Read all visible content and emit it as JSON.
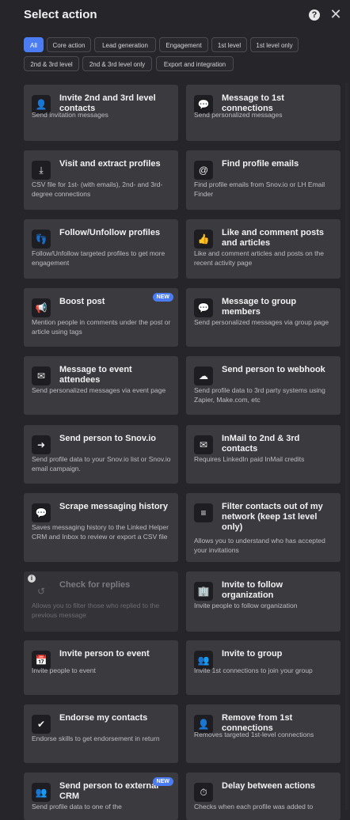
{
  "header": {
    "title": "Select action",
    "help_symbol": "?",
    "close_symbol": "✕"
  },
  "filters": [
    {
      "label": "All",
      "active": true
    },
    {
      "label": "Core action",
      "active": false
    },
    {
      "label": "Lead generation",
      "active": false
    },
    {
      "label": "Engagement",
      "active": false
    },
    {
      "label": "1st level",
      "active": false
    },
    {
      "label": "1st level only",
      "active": false
    },
    {
      "label": "2nd & 3rd level",
      "active": false
    },
    {
      "label": "2nd & 3rd level only",
      "active": false
    },
    {
      "label": "Export and integration",
      "active": false
    }
  ],
  "cards": [
    {
      "title": "Invite 2nd and 3rd level contacts",
      "desc": "Send invitation messages",
      "icon": "invite-user-icon",
      "glyph": "👤"
    },
    {
      "title": "Message to 1st connections",
      "desc": "Send personalized messages",
      "icon": "message-bubble-icon",
      "glyph": "💬"
    },
    {
      "title": "Visit and extract profiles",
      "desc": "CSV file for 1st- (with emails), 2nd- and 3rd-degree connections",
      "icon": "user-download-icon",
      "glyph": "⤓"
    },
    {
      "title": "Find profile emails",
      "desc": "Find profile emails from Snov.io or LH Email Finder",
      "icon": "at-sign-icon",
      "glyph": "@"
    },
    {
      "title": "Follow/Unfollow profiles",
      "desc": "Follow/Unfollow targeted profiles to get more engagement",
      "icon": "footsteps-icon",
      "glyph": "👣"
    },
    {
      "title": "Like and comment posts and articles",
      "desc": "Like and comment articles and posts on the recent activity page",
      "icon": "thumbs-up-icon",
      "glyph": "👍"
    },
    {
      "title": "Boost post",
      "desc": "Mention people in comments under the post or article using tags",
      "icon": "megaphone-icon",
      "glyph": "📢",
      "badge": "NEW"
    },
    {
      "title": "Message to group members",
      "desc": "Send personalized messages via group page",
      "icon": "group-message-icon",
      "glyph": "💬"
    },
    {
      "title": "Message to event attendees",
      "desc": "Send personalized messages via event page",
      "icon": "event-message-icon",
      "glyph": "✉"
    },
    {
      "title": "Send person to webhook",
      "desc": "Send profile data to 3rd party systems using Zapier, Make.com, etc",
      "icon": "cloud-upload-icon",
      "glyph": "☁"
    },
    {
      "title": "Send person to Snov.io",
      "desc": "Send profile data to your Snov.io list or Snov.io email campaign.",
      "icon": "user-send-icon",
      "glyph": "➜"
    },
    {
      "title": "InMail to 2nd & 3rd contacts",
      "desc": "Requires LinkedIn paid InMail credits",
      "icon": "envelope-icon",
      "glyph": "✉"
    },
    {
      "title": "Scrape messaging history",
      "desc": "Saves messaging history to the Linked Helper CRM and Inbox to review or export a CSV file",
      "icon": "chat-scrape-icon",
      "glyph": "💬"
    },
    {
      "title": "Filter contacts out of my network (keep 1st level only)",
      "desc": "Allows you to understand who has accepted your invitations",
      "icon": "filter-icon",
      "glyph": "≡"
    },
    {
      "title": "Check for replies",
      "desc": "Allows you to filter those who replied to the previous message",
      "icon": "reply-check-icon",
      "glyph": "↺",
      "disabled": true,
      "info": "i"
    },
    {
      "title": "Invite to follow organization",
      "desc": "Invite people to follow organization",
      "icon": "organization-icon",
      "glyph": "🏢"
    },
    {
      "title": "Invite person to event",
      "desc": "Invite people to event",
      "icon": "calendar-icon",
      "glyph": "📅"
    },
    {
      "title": "Invite to group",
      "desc": "Invite 1st connections to join your group",
      "icon": "group-invite-icon",
      "glyph": "👥"
    },
    {
      "title": "Endorse my contacts",
      "desc": "Endorse skills to get endorsement in return",
      "icon": "clipboard-check-icon",
      "glyph": "✔"
    },
    {
      "title": "Remove from 1st connections",
      "desc": "Removes targeted 1st-level connections",
      "icon": "user-remove-icon",
      "glyph": "👤"
    },
    {
      "title": "Send person to external CRM",
      "desc": "Send profile data to one of the",
      "icon": "crm-send-icon",
      "glyph": "👥",
      "badge": "NEW"
    },
    {
      "title": "Delay between actions",
      "desc": "Checks when each profile was added to",
      "icon": "timer-icon",
      "glyph": "⏱"
    }
  ]
}
